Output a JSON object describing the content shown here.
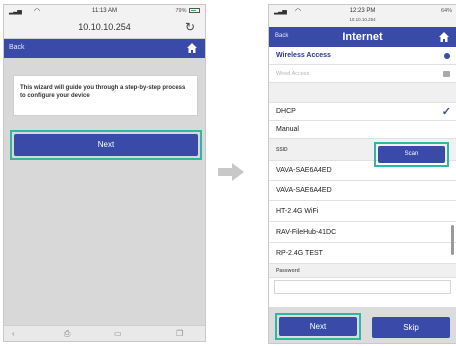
{
  "left_phone": {
    "status": {
      "time": "11:13 AM",
      "battery": "79%"
    },
    "address": "10.10.10.254",
    "nav": {
      "back_label": "Back"
    },
    "wizard_text": "This wizard will guide you through a step-by-step process to configure your device",
    "next_label": "Next"
  },
  "right_phone": {
    "status": {
      "time": "12:23 PM",
      "url": "10.10.10.254",
      "battery": "64%"
    },
    "nav": {
      "back_label": "Back",
      "title": "Internet"
    },
    "access_options": [
      {
        "label": "Wireless Access"
      },
      {
        "label": "Wired Access"
      }
    ],
    "mode_options": [
      {
        "label": "DHCP",
        "selected": true
      },
      {
        "label": "Manual"
      }
    ],
    "ssid_label": "SSID",
    "scan_label": "Scan",
    "ssid_list": [
      "VAVA-SAE6A4ED",
      "VAVA-SAE6A4ED",
      "HT-2.4G WiFi",
      "RAV-FileHub-41DC",
      "RP-2.4G TEST"
    ],
    "password_label": "Password",
    "next_label": "Next",
    "skip_label": "Skip"
  },
  "colors": {
    "brand": "#3a4aa8",
    "highlight": "#2fb7a4",
    "arrow": "#c8c8c8"
  }
}
